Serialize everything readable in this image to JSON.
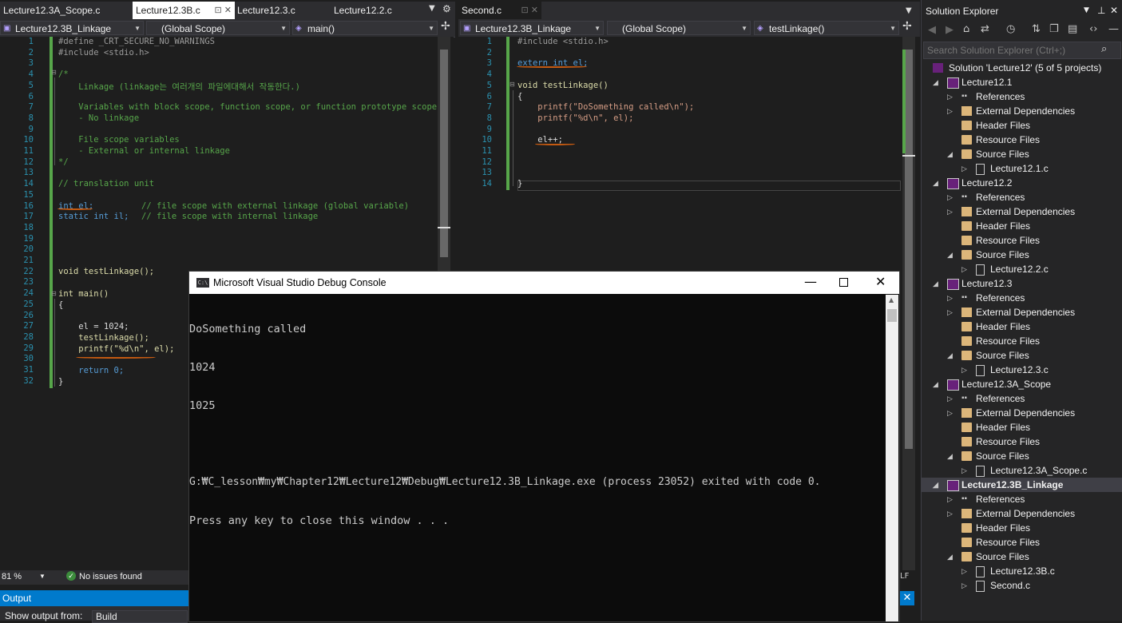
{
  "left_tabs": [
    "Lecture12.3A_Scope.c",
    "Lecture12.3B.c",
    "Lecture12.3.c",
    "Lecture12.2.c"
  ],
  "right_tabs": [
    "Second.c"
  ],
  "left_nav": {
    "project": "Lecture12.3B_Linkage",
    "scope": "(Global Scope)",
    "member": "main()"
  },
  "right_nav": {
    "project": "Lecture12.3B_Linkage",
    "scope": "(Global Scope)",
    "member": "testLinkage()"
  },
  "left_code": {
    "line_numbers": [
      "1",
      "2",
      "3",
      "4",
      "5",
      "6",
      "7",
      "8",
      "9",
      "10",
      "11",
      "12",
      "13",
      "14",
      "15",
      "16",
      "17",
      "18",
      "19",
      "20",
      "21",
      "22",
      "23",
      "24",
      "25",
      "26",
      "27",
      "28",
      "29",
      "30",
      "31",
      "32"
    ],
    "l1": "#define _CRT_SECURE_NO_WARNINGS",
    "l2": "#include <stdio.h>",
    "l4": "/*",
    "l5": "    Linkage (linkage는 여러개의 파일에대해서 작동한다.)",
    "l7": "    Variables with block scope, function scope, or function prototype scope",
    "l8": "    - No linkage",
    "l10": "    File scope variables",
    "l11": "    - External or internal linkage",
    "l12": "*/",
    "l14": "// translation unit",
    "l16a": "int el;",
    "l16b": "// file scope with external linkage (global variable)",
    "l17a": "static int il;",
    "l17b": "// file scope with internal linkage",
    "l22": "void testLinkage();",
    "l24": "int main()",
    "l25": "{",
    "l27": "    el = 1024;",
    "l28": "    testLinkage();",
    "l29": "    printf(\"%d\\n\", el);",
    "l31": "    return 0;",
    "l32": "}"
  },
  "right_code": {
    "line_numbers": [
      "1",
      "2",
      "3",
      "4",
      "5",
      "6",
      "7",
      "8",
      "9",
      "10",
      "11",
      "12",
      "13",
      "14"
    ],
    "r1": "#include <stdio.h>",
    "r3": "extern int el;",
    "r5": "void testLinkage()",
    "r6": "{",
    "r7": "    printf(\"DoSomething called\\n\");",
    "r8": "    printf(\"%d\\n\", el);",
    "r10": "    el++;",
    "r14": "}"
  },
  "status": {
    "zoom": "81 %",
    "issues": "No issues found",
    "line_ending": "LF"
  },
  "output": {
    "title": "Output",
    "show_from_label": "Show output from:",
    "show_from_value": "Build"
  },
  "console": {
    "title": "Microsoft Visual Studio Debug Console",
    "icon_text": "C:\\",
    "lines": [
      "DoSomething called",
      "1024",
      "1025",
      "",
      "G:₩C_lesson₩my₩Chapter12₩Lecture12₩Debug₩Lecture12.3B_Linkage.exe (process 23052) exited with code 0.",
      "Press any key to close this window . . ."
    ]
  },
  "solution_explorer": {
    "title": "Solution Explorer",
    "search_placeholder": "Search Solution Explorer (Ctrl+;)",
    "solution": "Solution 'Lecture12' (5 of 5 projects)",
    "rows": [
      {
        "label": "Lecture12.1",
        "kind": "project",
        "level": 1,
        "tri": "open"
      },
      {
        "label": "References",
        "kind": "ref",
        "level": 2,
        "tri": "closed"
      },
      {
        "label": "External Dependencies",
        "kind": "ext",
        "level": 2,
        "tri": "closed"
      },
      {
        "label": "Header Files",
        "kind": "folder",
        "level": 2,
        "tri": "none"
      },
      {
        "label": "Resource Files",
        "kind": "folder",
        "level": 2,
        "tri": "none"
      },
      {
        "label": "Source Files",
        "kind": "folder",
        "level": 2,
        "tri": "open"
      },
      {
        "label": "Lecture12.1.c",
        "kind": "file",
        "level": 3,
        "tri": "closed"
      },
      {
        "label": "Lecture12.2",
        "kind": "project",
        "level": 1,
        "tri": "open"
      },
      {
        "label": "References",
        "kind": "ref",
        "level": 2,
        "tri": "closed"
      },
      {
        "label": "External Dependencies",
        "kind": "ext",
        "level": 2,
        "tri": "closed"
      },
      {
        "label": "Header Files",
        "kind": "folder",
        "level": 2,
        "tri": "none"
      },
      {
        "label": "Resource Files",
        "kind": "folder",
        "level": 2,
        "tri": "none"
      },
      {
        "label": "Source Files",
        "kind": "folder",
        "level": 2,
        "tri": "open"
      },
      {
        "label": "Lecture12.2.c",
        "kind": "file",
        "level": 3,
        "tri": "closed"
      },
      {
        "label": "Lecture12.3",
        "kind": "project",
        "level": 1,
        "tri": "open"
      },
      {
        "label": "References",
        "kind": "ref",
        "level": 2,
        "tri": "closed"
      },
      {
        "label": "External Dependencies",
        "kind": "ext",
        "level": 2,
        "tri": "closed"
      },
      {
        "label": "Header Files",
        "kind": "folder",
        "level": 2,
        "tri": "none"
      },
      {
        "label": "Resource Files",
        "kind": "folder",
        "level": 2,
        "tri": "none"
      },
      {
        "label": "Source Files",
        "kind": "folder",
        "level": 2,
        "tri": "open"
      },
      {
        "label": "Lecture12.3.c",
        "kind": "file",
        "level": 3,
        "tri": "closed"
      },
      {
        "label": "Lecture12.3A_Scope",
        "kind": "project",
        "level": 1,
        "tri": "open"
      },
      {
        "label": "References",
        "kind": "ref",
        "level": 2,
        "tri": "closed"
      },
      {
        "label": "External Dependencies",
        "kind": "ext",
        "level": 2,
        "tri": "closed"
      },
      {
        "label": "Header Files",
        "kind": "folder",
        "level": 2,
        "tri": "none"
      },
      {
        "label": "Resource Files",
        "kind": "folder",
        "level": 2,
        "tri": "none"
      },
      {
        "label": "Source Files",
        "kind": "folder",
        "level": 2,
        "tri": "open"
      },
      {
        "label": "Lecture12.3A_Scope.c",
        "kind": "file",
        "level": 3,
        "tri": "closed"
      },
      {
        "label": "Lecture12.3B_Linkage",
        "kind": "project",
        "level": 1,
        "tri": "open",
        "selected": true
      },
      {
        "label": "References",
        "kind": "ref",
        "level": 2,
        "tri": "closed"
      },
      {
        "label": "External Dependencies",
        "kind": "ext",
        "level": 2,
        "tri": "closed"
      },
      {
        "label": "Header Files",
        "kind": "folder",
        "level": 2,
        "tri": "none"
      },
      {
        "label": "Resource Files",
        "kind": "folder",
        "level": 2,
        "tri": "none"
      },
      {
        "label": "Source Files",
        "kind": "folder",
        "level": 2,
        "tri": "open"
      },
      {
        "label": "Lecture12.3B.c",
        "kind": "file",
        "level": 3,
        "tri": "closed"
      },
      {
        "label": "Second.c",
        "kind": "file",
        "level": 3,
        "tri": "closed"
      }
    ]
  }
}
